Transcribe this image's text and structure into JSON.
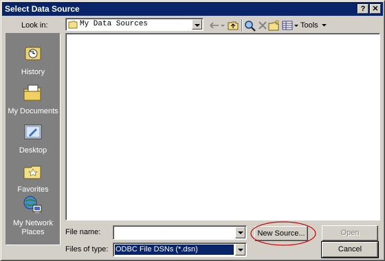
{
  "window": {
    "title": "Select Data Source"
  },
  "titlebar": {
    "help_glyph": "?",
    "close_glyph": "✕"
  },
  "lookin": {
    "label": "Look in:",
    "value": "My Data Sources"
  },
  "toolbar": {
    "tools_label": "Tools"
  },
  "places": [
    {
      "label": "History",
      "icon": "history-icon"
    },
    {
      "label": "My Documents",
      "icon": "my-documents-icon"
    },
    {
      "label": "Desktop",
      "icon": "desktop-icon"
    },
    {
      "label": "Favorites",
      "icon": "favorites-icon"
    },
    {
      "label": "My Network Places",
      "icon": "network-places-icon"
    }
  ],
  "filename": {
    "label": "File name:",
    "value": ""
  },
  "filetype": {
    "label": "Files of type:",
    "value": "ODBC File DSNs (*.dsn)"
  },
  "buttons": {
    "new_source": "New Source...",
    "open": "Open",
    "cancel": "Cancel"
  },
  "colors": {
    "titlebar": "#0a246a",
    "face": "#d4d0c8",
    "selection": "#0a246a",
    "annotation": "#cc0000"
  }
}
